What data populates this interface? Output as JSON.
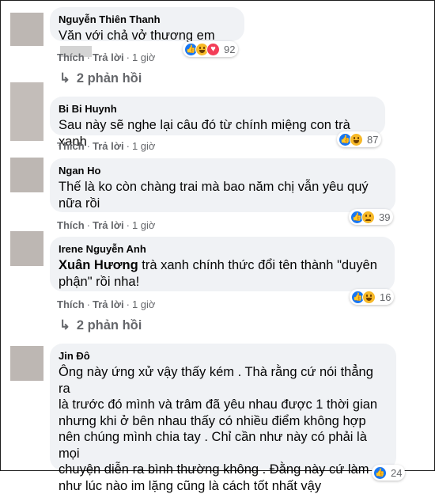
{
  "comments": [
    {
      "author": "Nguyễn Thiên Thanh",
      "text": "Văn với chả vở thương em",
      "actions": {
        "like": "Thích",
        "reply": "Trả lời",
        "time": "1 giờ"
      },
      "reaction_icons": [
        "like-icon",
        "haha-icon",
        "love-icon"
      ],
      "reaction_count": "92",
      "replies": "2 phản hồi"
    },
    {
      "author": "Bi Bi Huynh",
      "text": "Sau này sẽ nghe lại câu đó từ chính miệng con trà xanh",
      "actions": {
        "like": "Thích",
        "reply": "Trả lời",
        "time": "1 giờ"
      },
      "reaction_icons": [
        "like-icon",
        "haha-icon"
      ],
      "reaction_count": "87"
    },
    {
      "author": "Ngan Ho",
      "text_lines": [
        "Thế là ko còn chàng trai mà bao năm chị vẫn yêu quý",
        "nữa rồi"
      ],
      "actions": {
        "like": "Thích",
        "reply": "Trả lời",
        "time": "1 giờ"
      },
      "reaction_icons": [
        "like-icon",
        "sad-icon"
      ],
      "reaction_count": "39"
    },
    {
      "author": "Irene Nguyễn Anh",
      "mention": "Xuân Hương",
      "text_lines": [
        " trà xanh chính thức đổi tên thành \"duyên",
        "phận\" rồi nha!"
      ],
      "actions": {
        "like": "Thích",
        "reply": "Trả lời",
        "time": "1 giờ"
      },
      "reaction_icons": [
        "like-icon",
        "haha-icon"
      ],
      "reaction_count": "16",
      "replies": "2 phản hồi"
    },
    {
      "author": "Jin Đô",
      "text_lines": [
        "Ông này ứng xử vậy thấy kém . Thà rằng cứ nói thẳng ra",
        "là trước đó mình và trâm đã yêu nhau được 1 thời gian",
        "nhưng khi ở bên nhau thấy có nhiều điểm không hợp",
        "nên chúng mình chia tay . Chỉ cần như này có phải là mọi",
        "chuyện diễn ra bình thường không . Đằng này cứ làm",
        "như lúc nào im lặng cũng là cách tốt nhất vậy"
      ],
      "reaction_count": "24"
    }
  ],
  "colors": {
    "bubble": "#f0f2f5",
    "like": "#1877f2",
    "secondary_text": "#65676b"
  }
}
